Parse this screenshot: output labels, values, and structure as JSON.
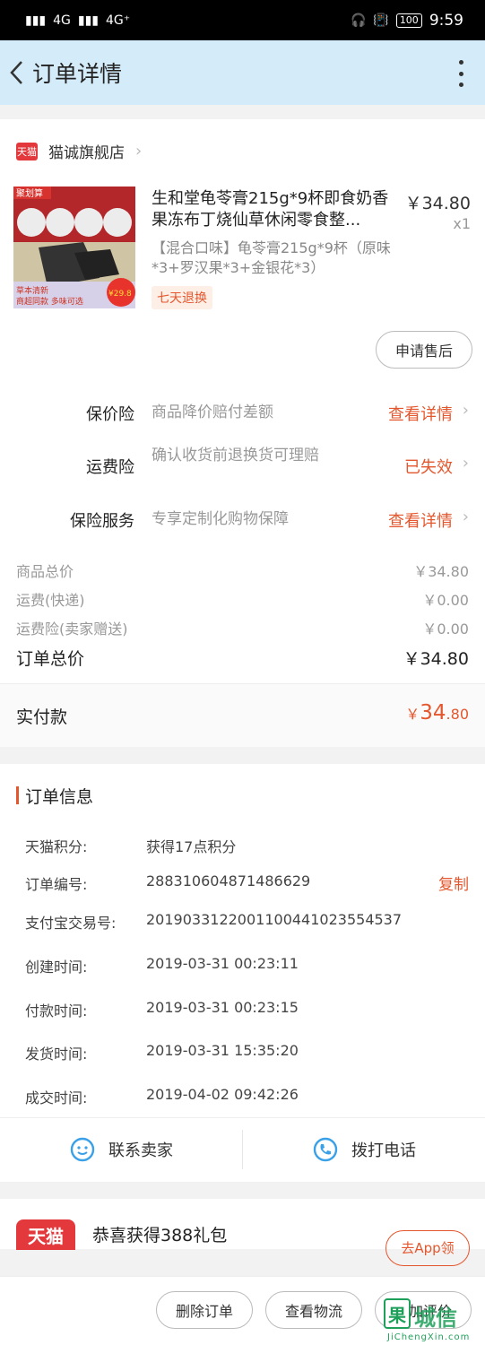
{
  "status_bar": {
    "signal_left": "4G",
    "signal_right": "4G⁺",
    "battery": "100",
    "time": "9:59"
  },
  "nav": {
    "title": "订单详情"
  },
  "store": {
    "badge": "天猫",
    "name": "猫诚旗舰店"
  },
  "product": {
    "name": "生和堂龟苓膏215g*9杯即食奶香果冻布丁烧仙草休闲零食整...",
    "price": "￥34.80",
    "qty": "x1",
    "sku": "【混合口味】龟苓膏215g*9杯（原味*3+罗汉果*3+金银花*3）",
    "badge": "七天退换",
    "thumb_top_label": "聚划算",
    "thumb_tag1": "草本清新",
    "thumb_tag2": "商超同款 多味可选",
    "thumb_price": "¥29.8"
  },
  "after_sale_button": "申请售后",
  "services": [
    {
      "label": "保价险",
      "desc": "商品降价赔付差额",
      "link": "查看详情"
    },
    {
      "label": "运费险",
      "desc": "确认收货前退换货可理赔",
      "link": "已失效"
    },
    {
      "label": "保险服务",
      "desc": "专享定制化购物保障",
      "link": "查看详情"
    }
  ],
  "fees": [
    {
      "label": "商品总价",
      "value": "￥34.80"
    },
    {
      "label": "运费(快递)",
      "value": "￥0.00"
    },
    {
      "label": "运费险(卖家赠送)",
      "value": "￥0.00"
    }
  ],
  "order_total": {
    "label": "订单总价",
    "value": "￥34.80"
  },
  "paid": {
    "label": "实付款",
    "currency": "￥",
    "int": "34",
    "dec": ".80"
  },
  "order_info": {
    "title": "订单信息",
    "rows": [
      {
        "label": "天猫积分:",
        "value": "获得17点积分"
      },
      {
        "label": "订单编号:",
        "value": "288310604871486629"
      },
      {
        "label": "支付宝交易号:",
        "value": "2019033122001100441023554537"
      },
      {
        "label": "创建时间:",
        "value": "2019-03-31 00:23:11"
      },
      {
        "label": "付款时间:",
        "value": "2019-03-31 00:23:15"
      },
      {
        "label": "发货时间:",
        "value": "2019-03-31 15:35:20"
      },
      {
        "label": "成交时间:",
        "value": "2019-04-02 09:42:26"
      }
    ],
    "copy": "复制"
  },
  "contact": {
    "seller": "联系卖家",
    "phone": "拨打电话"
  },
  "promo": {
    "logo": "天猫",
    "text": "恭喜获得388礼包",
    "button": "去App领"
  },
  "bottom": {
    "delete": "删除订单",
    "logistics": "查看物流",
    "review": "追加评价"
  },
  "watermark": {
    "logo": "果",
    "text": "城信",
    "url": "JiChengXin.com"
  },
  "colors": {
    "accent": "#e4572e",
    "nav_bg": "#d4ebf9",
    "tmall_red": "#e4393c"
  }
}
